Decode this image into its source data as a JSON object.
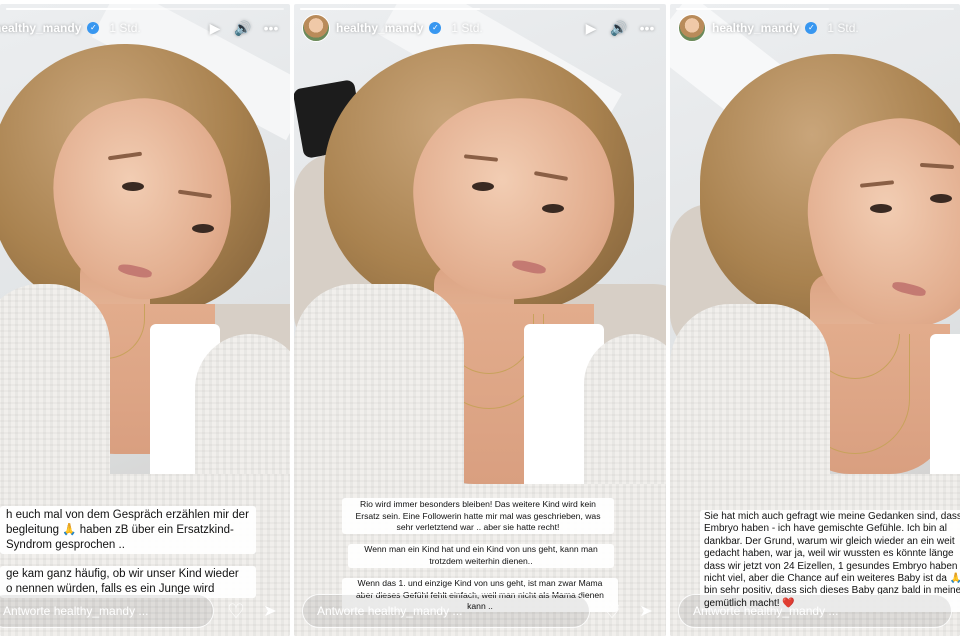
{
  "panels": [
    {
      "username": "healthy_mandy",
      "time": "1 Std.",
      "reply_placeholder": "Antworte healthy_mandy ...",
      "progress": 0.45,
      "captions": [
        "h euch mal von dem Gespräch erzählen mir der\nbegleitung 🙏 haben zB über ein Ersatzkind-\nSyndrom gesprochen ..",
        "ge kam ganz häufig, ob wir unser Kind wieder\no nennen würden, falls es ein Junge wird"
      ]
    },
    {
      "username": "healthy_mandy",
      "time": "1 Std.",
      "reply_placeholder": "Antworte healthy_mandy ...",
      "progress": 0.5,
      "captions": [
        "Rio wird immer besonders bleiben! Das weitere Kind wird kein\nErsatz sein. Eine Followerin hatte mir mal was geschrieben, was\nsehr verletztend war .. aber sie hatte recht!",
        "Wenn man ein Kind hat und ein Kind von uns geht, kann man\ntrotzdem weiterhin dienen..",
        "Wenn das 1. und einzige Kind von uns geht, ist man zwar Mama\naber dieses Gefühl fehlt einfach, weil man nicht als Mama dienen\nkann .."
      ]
    },
    {
      "username": "healthy_mandy",
      "time": "1 Std.",
      "reply_placeholder": "Antworte healthy_mandy ...",
      "progress": 0.55,
      "captions": [
        "Sie hat mich auch gefragt wie meine Gedanken sind, dass\nEmbryo haben - ich have gemischte Gefühle. Ich bin al\ndankbar. Der Grund, warum wir gleich wieder an ein weit\ngedacht haben, war ja, weil wir wussten es könnte länge\ndass wir jetzt von 24 Eizellen, 1 gesundes Embryo haben\nnicht viel, aber die Chance auf ein weiteres Baby ist da 🙏\nbin sehr positiv, dass sich dieses Baby ganz bald in meine\ngemütlich macht! ❤️"
      ]
    }
  ],
  "icons": {
    "play": "▶",
    "sound": "🔊",
    "more": "•••",
    "heart": "♡",
    "share": "➤",
    "verified": "✓"
  }
}
